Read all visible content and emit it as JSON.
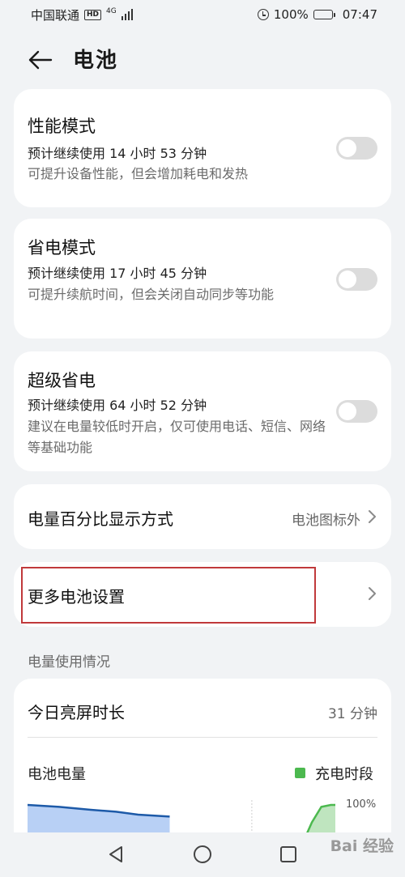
{
  "status_bar": {
    "carrier": "中国联通",
    "network_badge": "HD",
    "network_type": "4G",
    "battery_percent": "100%",
    "time": "07:47"
  },
  "header": {
    "title": "电池",
    "back_icon": "back-arrow-icon"
  },
  "modes": [
    {
      "title": "性能模式",
      "estimate": "预计继续使用 14 小时 53 分钟",
      "desc": "可提升设备性能，但会增加耗电和发热",
      "enabled": false
    },
    {
      "title": "省电模式",
      "estimate": "预计继续使用 17 小时 45 分钟",
      "desc": "可提升续航时间，但会关闭自动同步等功能",
      "enabled": false
    },
    {
      "title": "超级省电",
      "estimate": "预计继续使用 64 小时 52 分钟",
      "desc": "建议在电量较低时开启，仅可使用电话、短信、网络等基础功能",
      "enabled": false
    }
  ],
  "percent_display": {
    "label": "电量百分比显示方式",
    "value": "电池图标外"
  },
  "more_settings": {
    "label": "更多电池设置"
  },
  "usage": {
    "section_label": "电量使用情况",
    "screen_time_label": "今日亮屏时长",
    "screen_time_value": "31 分钟",
    "battery_level_label": "电池电量",
    "legend_label": "充电时段",
    "y_max_label": "100%"
  },
  "colors": {
    "accent_legend": "#4cb94f",
    "chart_fill": "#b8d0f5",
    "chart_line": "#1d5aa8",
    "highlight_border": "#c0393b"
  },
  "chart_data": {
    "type": "area",
    "title": "电池电量",
    "legend": [
      "充电时段"
    ],
    "ylim": [
      0,
      100
    ],
    "y_tick_labels": [
      "100%"
    ],
    "series": [
      {
        "name": "",
        "x": [
          0,
          0.1,
          0.2,
          0.28,
          0.35,
          0.45
        ],
        "values": [
          100,
          98,
          95,
          93,
          90,
          88
        ]
      },
      {
        "name": "充电时段",
        "x": [
          0.87,
          0.9,
          0.93,
          0.96,
          1.0
        ],
        "values": [
          60,
          82,
          98,
          100,
          100
        ]
      }
    ]
  },
  "nav_bar": {
    "back_icon": "nav-back-icon",
    "home_icon": "nav-home-icon",
    "recents_icon": "nav-recents-icon"
  },
  "watermark": {
    "text": "Bai 经验"
  }
}
